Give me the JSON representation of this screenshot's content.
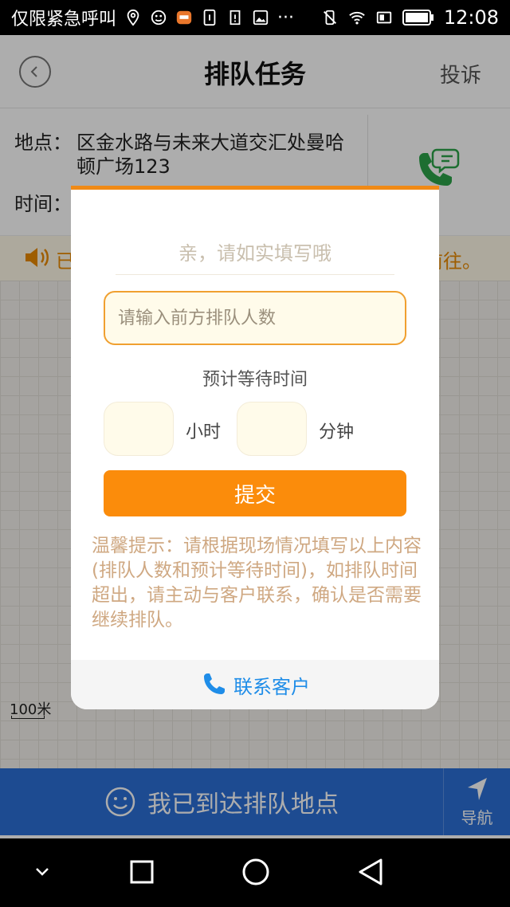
{
  "status_bar": {
    "left_text": "仅限紧急呼叫",
    "dots": "···",
    "time": "12:08"
  },
  "header": {
    "title": "排队任务",
    "right_action": "投诉"
  },
  "info": {
    "location_label": "地点：",
    "location_value": "区金水路与未来大道交汇处曼哈顿广场123",
    "time_label": "时间："
  },
  "notice": {
    "left_text": "已",
    "right_text": "前往。"
  },
  "map": {
    "scale_label": "100米"
  },
  "bottom_bar": {
    "arrive_label": "我已到达排队地点",
    "nav_label": "导航"
  },
  "dialog": {
    "hint": "亲，请如实填写哦",
    "queue_input_placeholder": "请输入前方排队人数",
    "wait_title": "预计等待时间",
    "hours_unit": "小时",
    "minutes_unit": "分钟",
    "submit_label": "提交",
    "tip": "温馨提示：请根据现场情况填写以上内容(排队人数和预计等待时间)，如排队时间超出，请主动与客户联系，确认是否需要继续排队。",
    "contact_label": "联系客户"
  },
  "colors": {
    "accent_orange": "#fb8c0b",
    "primary_blue": "#2b6fd6",
    "link_blue": "#1f8de8",
    "phone_green": "#2ba249"
  }
}
